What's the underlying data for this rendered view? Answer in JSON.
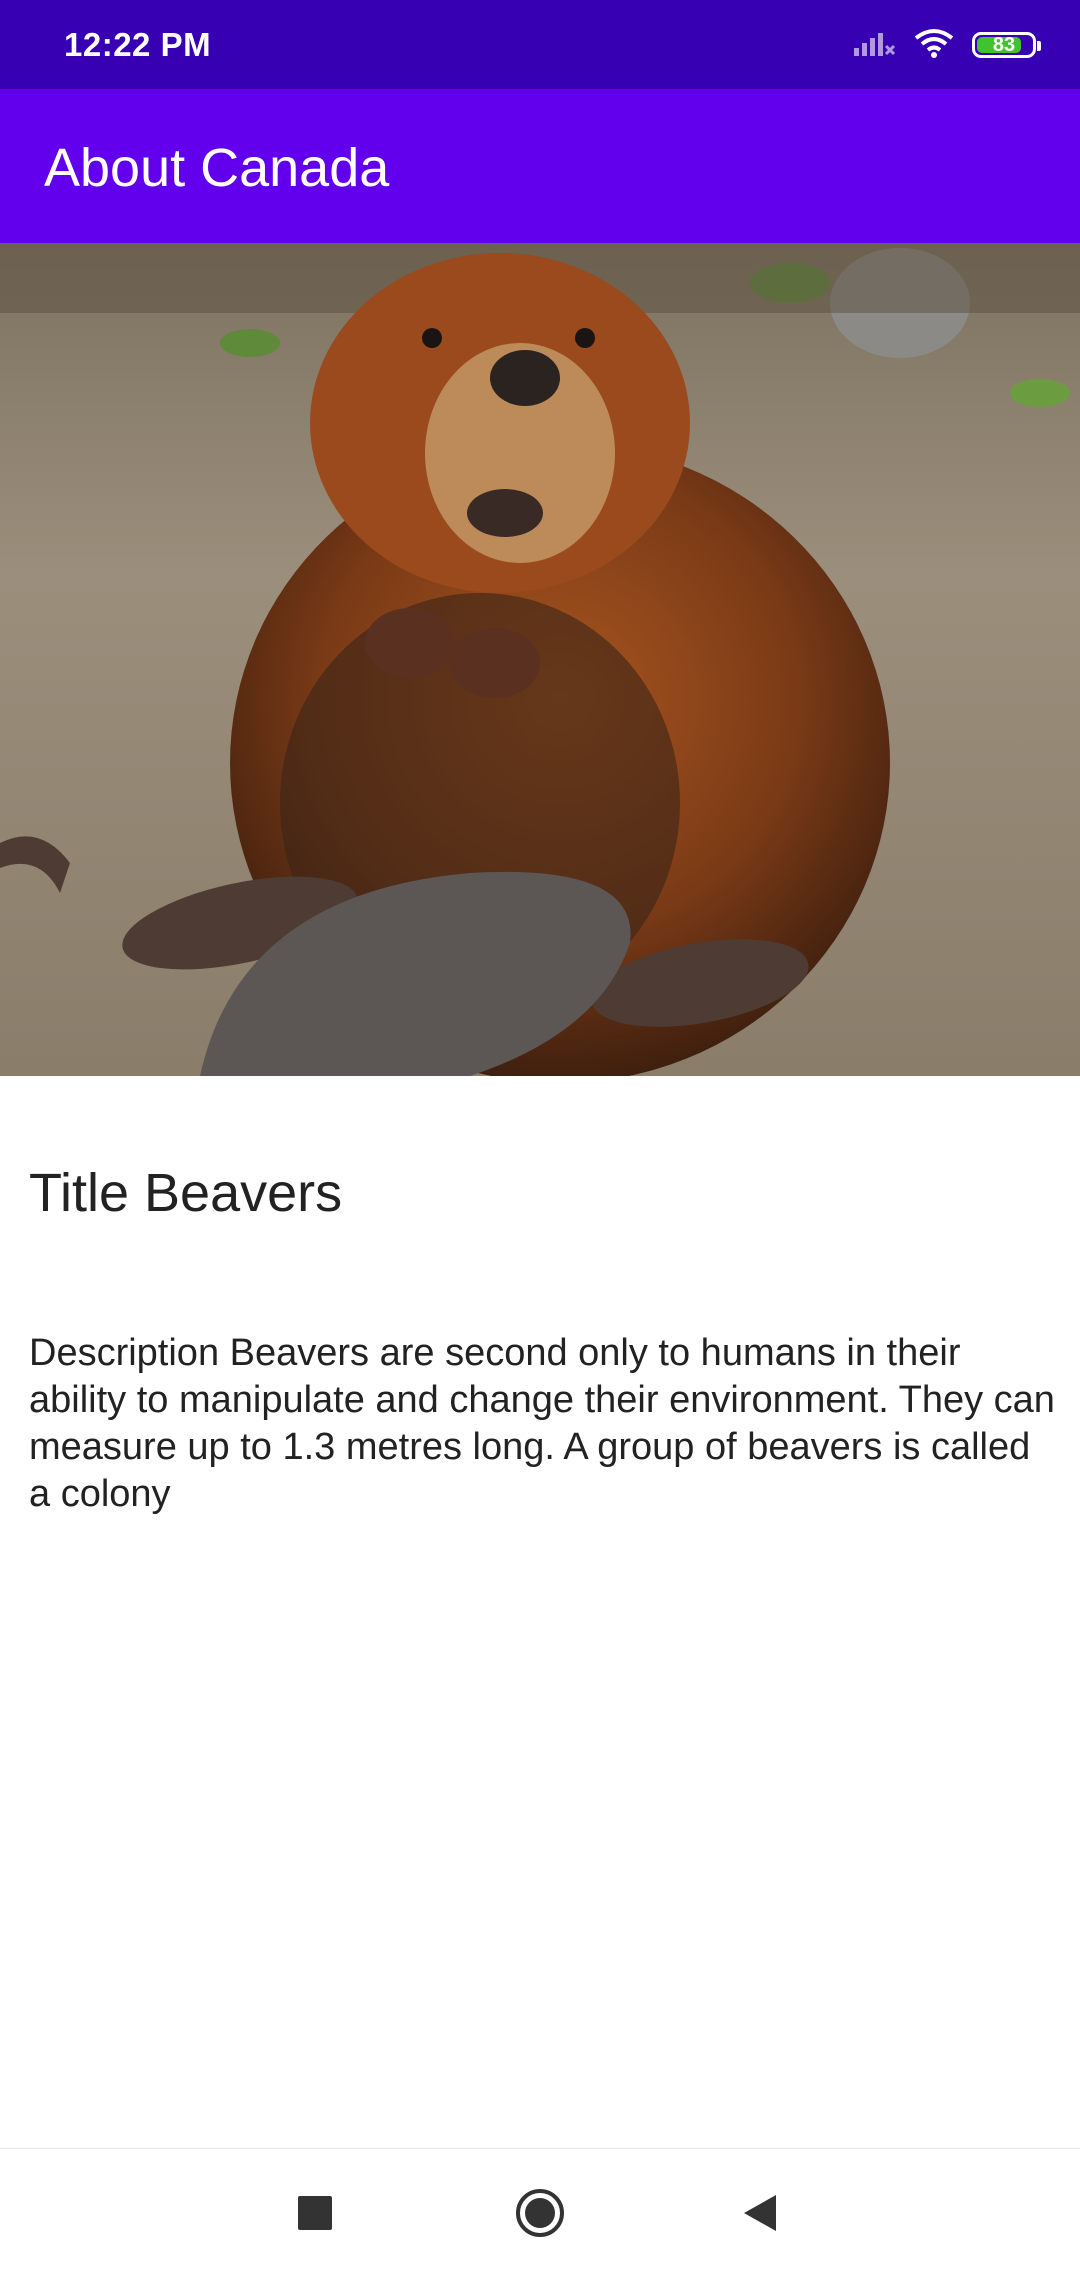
{
  "status_bar": {
    "time": "12:22 PM",
    "battery_level": "83",
    "battery_fraction": 0.83,
    "icons": [
      "signal-icon",
      "wifi-icon",
      "battery-icon"
    ]
  },
  "app_bar": {
    "title": "About Canada",
    "color": "#6200ee",
    "status_color": "#3700b3"
  },
  "content": {
    "image": "beaver-photo",
    "title": "Title Beavers",
    "description": "Description Beavers are second only to humans in their ability to manipulate and change their environment. They can measure up to 1.3 metres long. A group of beavers is called a colony"
  },
  "nav_bar": {
    "buttons": [
      "recents-square-icon",
      "home-circle-icon",
      "back-triangle-icon"
    ]
  }
}
